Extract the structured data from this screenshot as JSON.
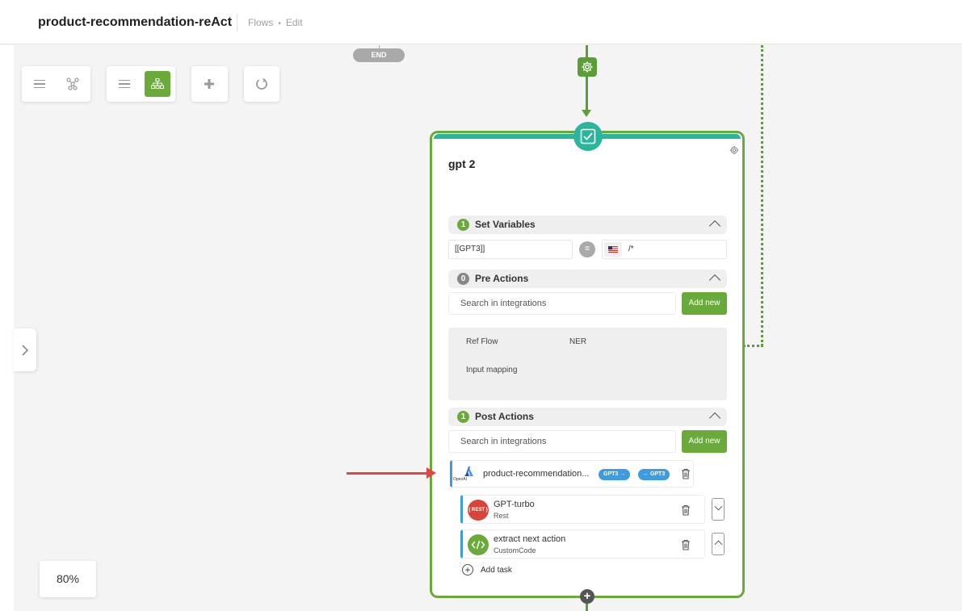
{
  "header": {
    "title": "product-recommendation-reAct",
    "breadcrumb": [
      "Flows",
      "Edit"
    ]
  },
  "canvas": {
    "end_label": "END",
    "zoom": "80%"
  },
  "colors": {
    "accent_green": "#6aaa3a",
    "node_teal": "#2bb59a",
    "link_blue": "#3d9be0",
    "rest_red": "#d9443a",
    "annotation_red": "#e54545"
  },
  "node": {
    "title": "gpt 2",
    "set_variables": {
      "count": "1",
      "title": "Set Variables",
      "variable_name": "[[GPT3]]",
      "operator": "=",
      "variable_value": "/*"
    },
    "pre_actions": {
      "count": "0",
      "title": "Pre Actions",
      "search_placeholder": "Search in integrations",
      "add_label": "Add new",
      "ref_flow_label": "Ref Flow",
      "ref_flow_value": "NER",
      "input_mapping_label": "Input mapping"
    },
    "post_actions": {
      "count": "1",
      "title": "Post Actions",
      "search_placeholder": "Search in integrations",
      "add_label": "Add new",
      "primary_action": {
        "name": "product-recommendation...",
        "logo_text": "OpenAI",
        "out_pill": "GPT3 →",
        "in_pill": "← GPT3"
      },
      "sub_actions": [
        {
          "name": "GPT-turbo",
          "type": "Rest",
          "icon": "rest-icon",
          "icon_text": "{ REST }"
        },
        {
          "name": "extract next action",
          "type": "CustomCode",
          "icon": "code-icon"
        }
      ],
      "add_task_label": "Add task"
    }
  }
}
